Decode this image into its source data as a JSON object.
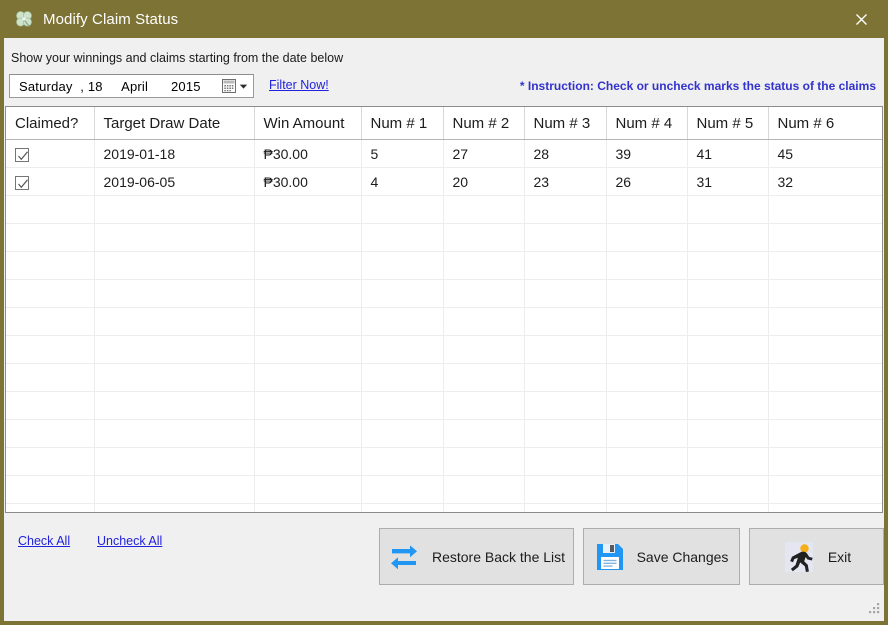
{
  "window": {
    "title": "Modify Claim Status",
    "icon": "clover-icon",
    "close_label": "✕",
    "border_color": "#7d7335",
    "titlebar_color": "#7d7335",
    "panel_color": "#f0f0f0"
  },
  "filter": {
    "hint": "Show your winnings and claims starting from the date below",
    "date_value": "Saturday  , 18     April      2015",
    "date_parts": {
      "weekday": "Saturday",
      "day": "18",
      "month": "April",
      "year": "2015"
    },
    "calendar_icon": "calendar-icon",
    "dropdown_icon": "chevron-down-icon",
    "filter_now_label": "Filter Now!",
    "instruction": "* Instruction: Check or uncheck marks the status of the claims",
    "link_color": "#2222dd",
    "instruction_color": "#3333cc"
  },
  "grid": {
    "columns": [
      "Claimed?",
      "Target Draw Date",
      "Win Amount",
      "Num # 1",
      "Num # 2",
      "Num # 3",
      "Num # 4",
      "Num # 5",
      "Num # 6"
    ],
    "rows": [
      {
        "claimed": true,
        "target_draw_date": "2019-01-18",
        "win_amount": "₱30.00",
        "num1": "5",
        "num2": "27",
        "num3": "28",
        "num4": "39",
        "num5": "41",
        "num6": "45"
      },
      {
        "claimed": true,
        "target_draw_date": "2019-06-05",
        "win_amount": "₱30.00",
        "num1": "4",
        "num2": "20",
        "num3": "23",
        "num4": "26",
        "num5": "31",
        "num6": "32"
      }
    ],
    "empty_row_count": 12
  },
  "footer": {
    "check_all_label": "Check All",
    "uncheck_all_label": "Uncheck All",
    "buttons": [
      {
        "label": "Restore Back the List",
        "icon": "refresh-arrows-icon"
      },
      {
        "label": "Save Changes",
        "icon": "floppy-disk-save-icon"
      },
      {
        "label": "Exit",
        "icon": "running-person-exit-icon"
      }
    ]
  }
}
